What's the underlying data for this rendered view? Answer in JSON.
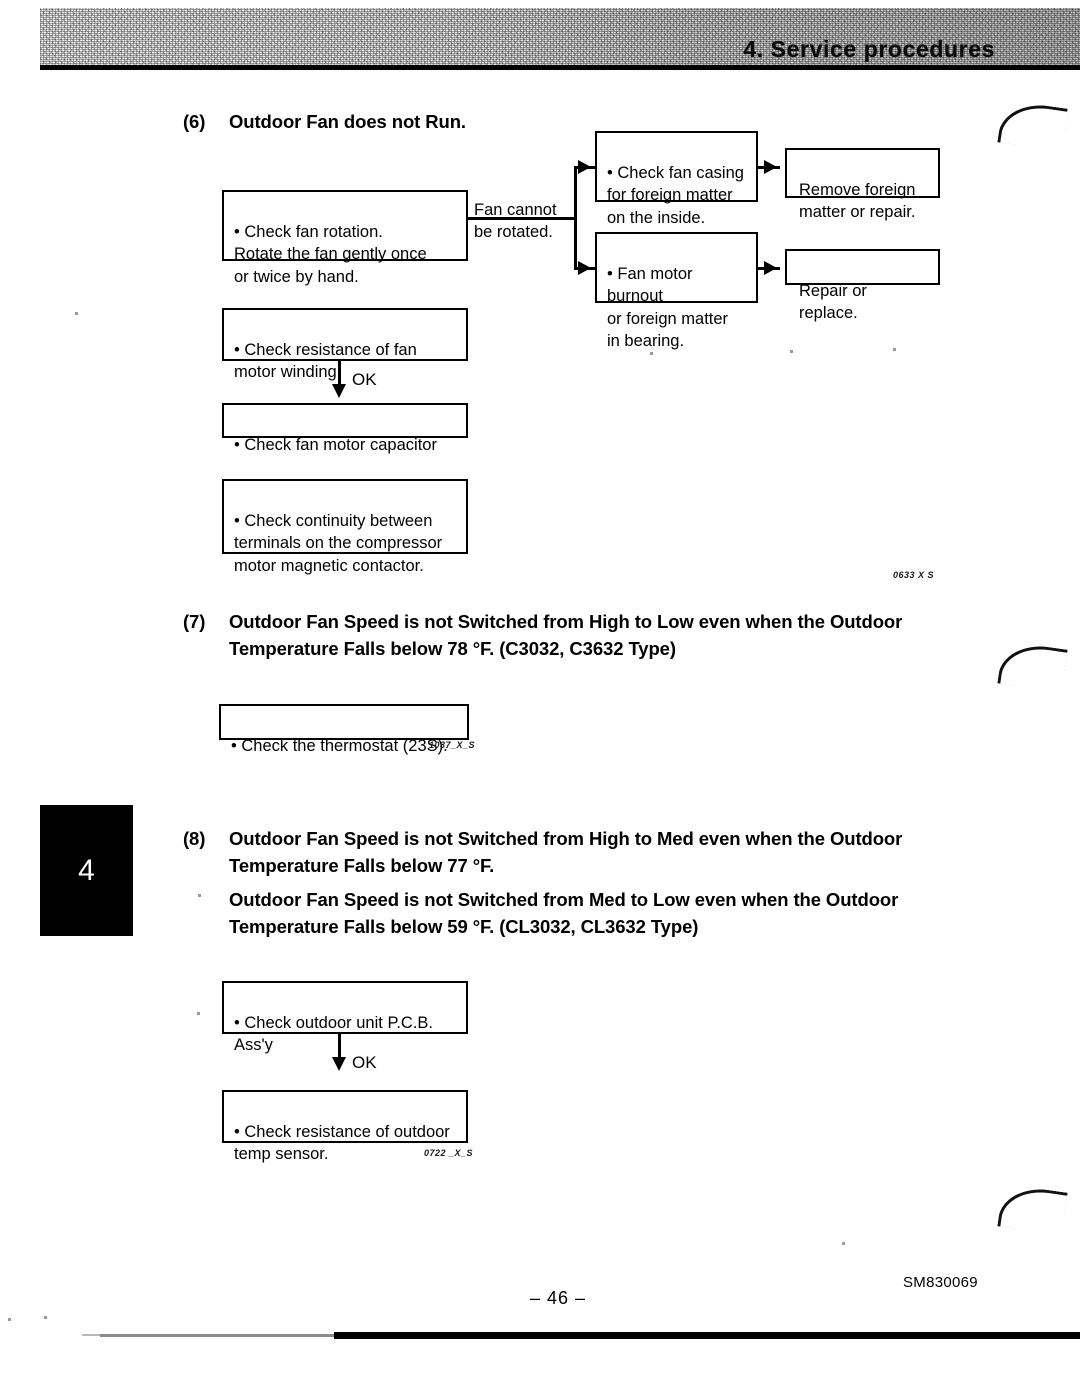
{
  "header": {
    "title": "4. Service procedures"
  },
  "chapter_tab": {
    "number": "4"
  },
  "sections": [
    {
      "number": "(6)",
      "heading": "Outdoor Fan does not Run.",
      "figure_code": "0633 X S",
      "flow": {
        "box_check_fan_rotation": "• Check fan rotation.\n   Rotate the fan gently once\n   or twice by hand.",
        "label_fan_cannot_be_rotated": "Fan cannot\nbe rotated.",
        "box_check_fan_casing": "• Check fan casing\n   for foreign matter\n   on the inside.",
        "box_remove_foreign_matter": "Remove foreign\nmatter or repair.",
        "box_fan_motor_burnout": "• Fan motor burnout\n   or foreign matter\n   in bearing.",
        "box_repair_or_replace": "Repair or replace.",
        "box_check_resistance_winding": "• Check resistance of fan\n   motor winding.",
        "ok_label": "OK",
        "box_check_fan_capacitor": "• Check fan motor capacitor",
        "box_check_continuity": "• Check continuity between\n   terminals on the compressor\n   motor magnetic contactor."
      }
    },
    {
      "number": "(7)",
      "heading": "Outdoor Fan Speed is not Switched from High to Low even when the Outdoor Temperature Falls below 78 °F. (C3032, C3632 Type)",
      "figure_code": "1037_X_S",
      "flow": {
        "box_check_thermostat": "• Check the thermostat (23S)."
      }
    },
    {
      "number": "(8)",
      "heading": "Outdoor Fan Speed is not Switched from High to Med even when the Outdoor Temperature Falls below 77 °F.",
      "heading2": "Outdoor Fan Speed is not Switched from Med to Low even when the Outdoor Temperature Falls below 59 °F. (CL3032, CL3632 Type)",
      "figure_code": "0722 _X_S",
      "flow": {
        "box_check_pcb": "• Check outdoor unit P.C.B.\n   Ass'y",
        "ok_label": "OK",
        "box_check_temp_sensor": "• Check resistance of outdoor\n   temp sensor."
      }
    }
  ],
  "footer": {
    "page_number": "– 46 –",
    "document_code": "SM830069"
  }
}
